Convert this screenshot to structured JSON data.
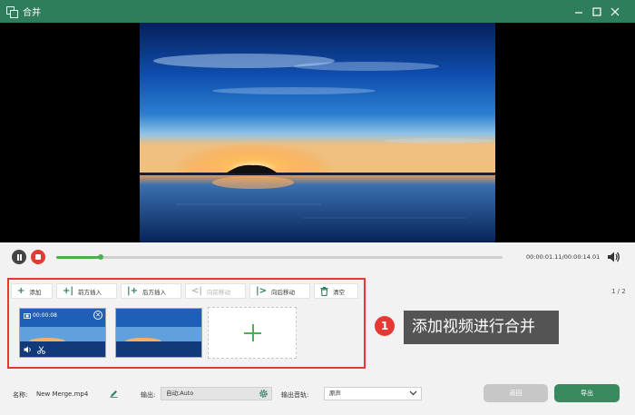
{
  "window": {
    "title": "合并",
    "controls": [
      "minimize-icon",
      "maximize-icon",
      "close-icon"
    ]
  },
  "player": {
    "time_display": "00:00:01.11/00:00:14.01",
    "progress": 0.1
  },
  "toolbar": {
    "add": "添加",
    "insert_before": "前方插入",
    "insert_after": "后方插入",
    "move_forward": "向前移动",
    "move_backward": "向后移动",
    "clear": "清空"
  },
  "page_count": "1 / 2",
  "clips": [
    {
      "duration": "00:00:08",
      "selected": true
    }
  ],
  "callout": {
    "number": "1",
    "text": "添加视频进行合并"
  },
  "bottom": {
    "name_label": "名称:",
    "name_value": "New Merge.mp4",
    "output_label": "输出:",
    "output_value": "自动;Auto",
    "track_label": "输出音轨:",
    "track_value": "原声",
    "back_label": "返回",
    "export_label": "导出"
  },
  "colors": {
    "brand": "#2e7d5b",
    "progress": "#4caf50",
    "highlight": "#e53935",
    "callout_bg": "#545454"
  }
}
